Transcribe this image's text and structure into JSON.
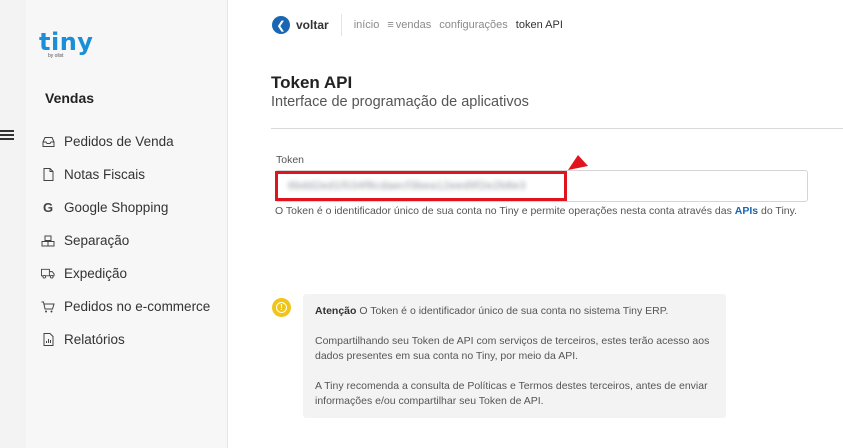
{
  "brand": {
    "logo_text": "tiny",
    "logo_sub": "by olist"
  },
  "sidebar": {
    "section_title": "Vendas",
    "items": [
      {
        "label": "Pedidos de Venda",
        "icon": "inbox-icon"
      },
      {
        "label": "Notas Fiscais",
        "icon": "document-icon"
      },
      {
        "label": "Google Shopping",
        "icon": "google-icon"
      },
      {
        "label": "Separação",
        "icon": "boxes-icon"
      },
      {
        "label": "Expedição",
        "icon": "truck-icon"
      },
      {
        "label": "Pedidos no e-commerce",
        "icon": "cart-icon"
      },
      {
        "label": "Relatórios",
        "icon": "report-icon"
      }
    ]
  },
  "breadcrumb": {
    "back_label": "voltar",
    "items": [
      "início",
      "vendas",
      "configurações"
    ],
    "current": "token API"
  },
  "page": {
    "title": "Token API",
    "subtitle": "Interface de programação de aplicativos"
  },
  "token": {
    "label": "Token",
    "value": "6bdd2ed1f034f8cdaecf3bea12eed9f2e2b8e3",
    "help_prefix": "O Token é o identificador único de sua conta no Tiny e permite operações nesta conta através das ",
    "help_link": "APIs",
    "help_suffix": " do Tiny."
  },
  "notice": {
    "lead_bold": "Atenção",
    "lead_text": " O Token é o identificador único de sua conta no sistema Tiny ERP.",
    "paragraph_2": "Compartilhando seu Token de API com serviços de terceiros, estes terão acesso aos dados presentes em sua conta no Tiny, por meio da API.",
    "paragraph_3": "A Tiny recomenda a consulta de Políticas e Termos destes terceiros, antes de enviar informações e/ou compartilhar seu Token de API."
  },
  "colors": {
    "brand_blue": "#1a8fd8",
    "back_button": "#1a66b3",
    "annotation_red": "#e0141f",
    "warning_yellow": "#f0c419"
  }
}
